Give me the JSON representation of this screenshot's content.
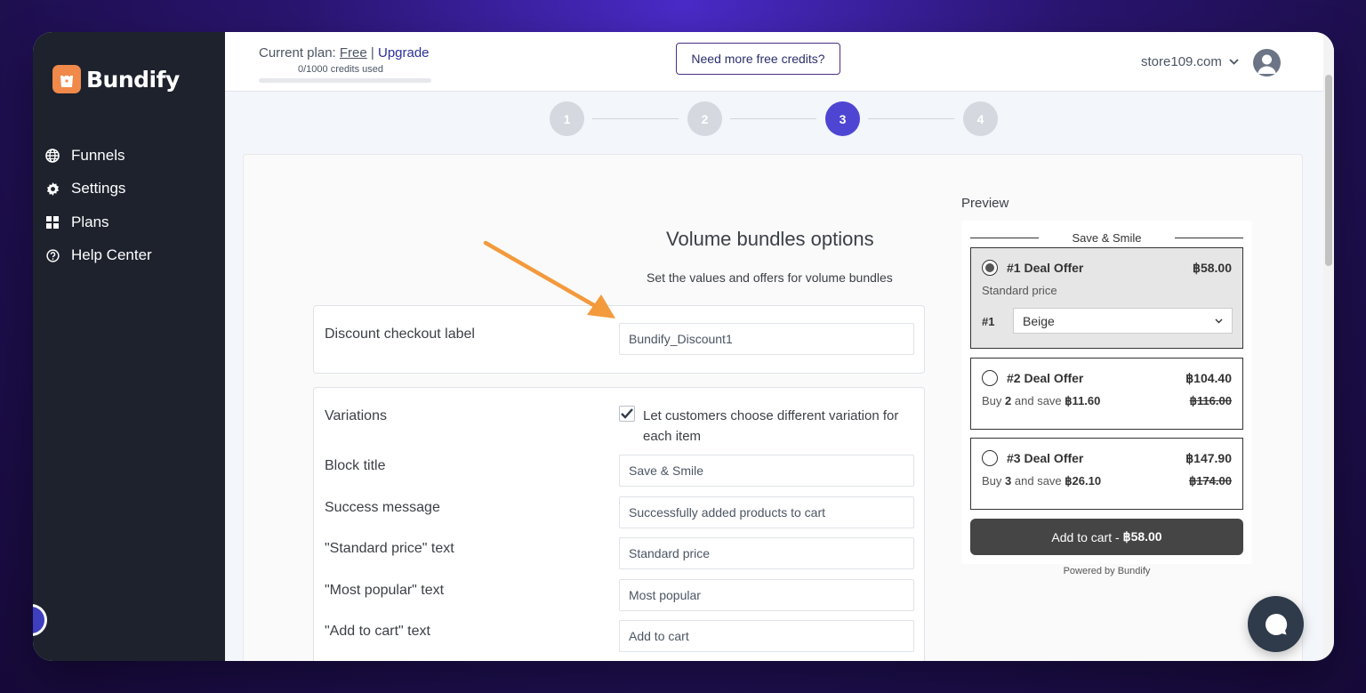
{
  "brand": {
    "name": "Bundify"
  },
  "sidebar": {
    "items": [
      {
        "label": "Funnels",
        "icon": "globe-icon"
      },
      {
        "label": "Settings",
        "icon": "gear-icon"
      },
      {
        "label": "Plans",
        "icon": "grid-icon"
      },
      {
        "label": "Help Center",
        "icon": "help-icon"
      }
    ]
  },
  "topbar": {
    "plan_prefix": "Current plan:",
    "plan_name": "Free",
    "separator": "|",
    "upgrade_label": "Upgrade",
    "credits_text": "0/1000 credits used",
    "credits_used_fraction": 0,
    "free_credits_button": "Need more free credits?",
    "store": "store109.com"
  },
  "steps": {
    "items": [
      "1",
      "2",
      "3",
      "4"
    ],
    "active": 3
  },
  "form": {
    "title": "Volume bundles options",
    "subtitle": "Set the values and offers for volume bundles",
    "discount_label": {
      "label": "Discount checkout label",
      "value": "Bundify_Discount1"
    },
    "variations": {
      "label": "Variations",
      "checkbox_label": "Let customers choose different variation for each item",
      "checked": true
    },
    "block_title": {
      "label": "Block title",
      "value": "Save & Smile"
    },
    "success_message": {
      "label": "Success message",
      "value": "Successfully added products to cart"
    },
    "standard_price": {
      "label": "\"Standard price\" text",
      "value": "Standard price"
    },
    "most_popular": {
      "label": "\"Most popular\" text",
      "value": "Most popular"
    },
    "add_to_cart": {
      "label": "\"Add to cart\" text",
      "value": "Add to cart"
    }
  },
  "preview": {
    "label": "Preview",
    "block_title": "Save & Smile",
    "offers": [
      {
        "name": "#1 Deal Offer",
        "price": "฿58.00",
        "sub": "Standard price",
        "variant_num": "#1",
        "variant_value": "Beige",
        "selected": true
      },
      {
        "name": "#2 Deal Offer",
        "price": "฿104.40",
        "sub_prefix": "Buy",
        "qty": "2",
        "sub_mid": "and save",
        "saving": "฿11.60",
        "old_price": "฿116.00"
      },
      {
        "name": "#3 Deal Offer",
        "price": "฿147.90",
        "sub_prefix": "Buy",
        "qty": "3",
        "sub_mid": "and save",
        "saving": "฿26.10",
        "old_price": "฿174.00"
      }
    ],
    "atc_label": "Add to cart -",
    "atc_price": "฿58.00",
    "powered_prefix": "Powered by",
    "powered_brand": "Bundify"
  },
  "colors": {
    "accent": "#4e46d3",
    "sidebar": "#1d222d",
    "arrow": "#f39a3c",
    "logo": "#f0894a"
  }
}
